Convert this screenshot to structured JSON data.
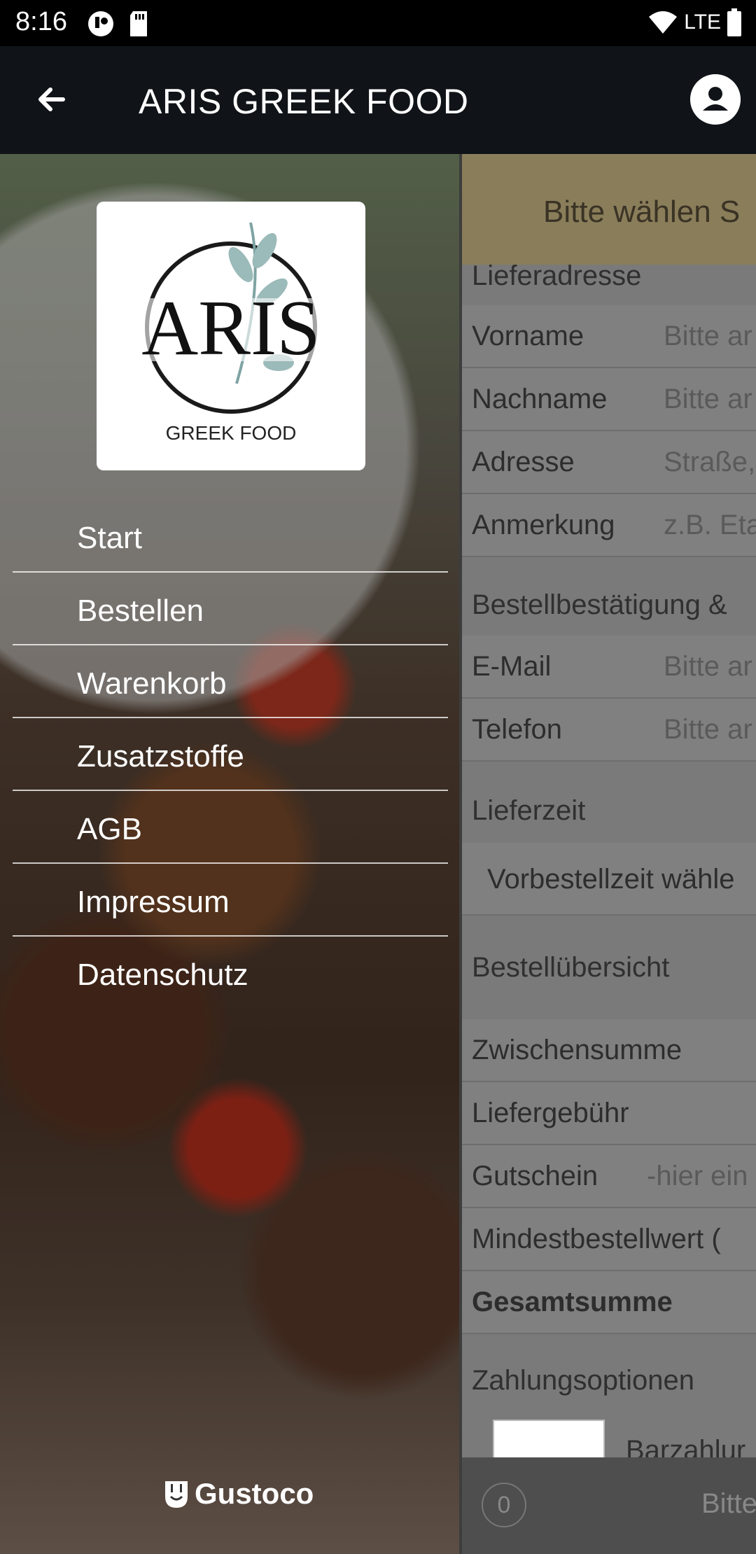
{
  "status_bar": {
    "time": "8:16",
    "network": "LTE"
  },
  "app_bar": {
    "title": "ARIS GREEK FOOD"
  },
  "drawer": {
    "logo": {
      "text": "ARIS",
      "subtext": "GREEK FOOD"
    },
    "menu": [
      {
        "label": "Start"
      },
      {
        "label": "Bestellen"
      },
      {
        "label": "Warenkorb"
      },
      {
        "label": "Zusatzstoffe"
      },
      {
        "label": "AGB"
      },
      {
        "label": "Impressum"
      },
      {
        "label": "Datenschutz"
      }
    ],
    "footer_brand": "Gustoco"
  },
  "background_page": {
    "banner": "Bitte wählen S",
    "lieferadresse": {
      "heading": "Lieferadresse",
      "fields": [
        {
          "label": "Vorname",
          "placeholder": "Bitte ar"
        },
        {
          "label": "Nachname",
          "placeholder": "Bitte ar"
        },
        {
          "label": "Adresse",
          "placeholder": "Straße,"
        },
        {
          "label": "Anmerkung",
          "placeholder": "z.B. Eta"
        }
      ]
    },
    "kontakt": {
      "heading": "Bestellbestätigung &",
      "fields": [
        {
          "label": "E-Mail",
          "placeholder": "Bitte ar"
        },
        {
          "label": "Telefon",
          "placeholder": "Bitte ar"
        }
      ]
    },
    "lieferzeit": {
      "heading": "Lieferzeit",
      "select": "Vorbestellzeit wähle"
    },
    "uebersicht": {
      "heading": "Bestellübersicht",
      "rows": [
        {
          "label": "Zwischensumme"
        },
        {
          "label": "Liefergebühr"
        },
        {
          "label": "Gutschein",
          "placeholder": "-hier ein"
        },
        {
          "label": "Mindestbestellwert ("
        },
        {
          "label": "Gesamtsumme"
        }
      ]
    },
    "zahlung": {
      "heading": "Zahlungsoptionen",
      "option": "Barzahlur"
    },
    "bottom_bar": {
      "count": "0",
      "text": "Bitte"
    }
  }
}
